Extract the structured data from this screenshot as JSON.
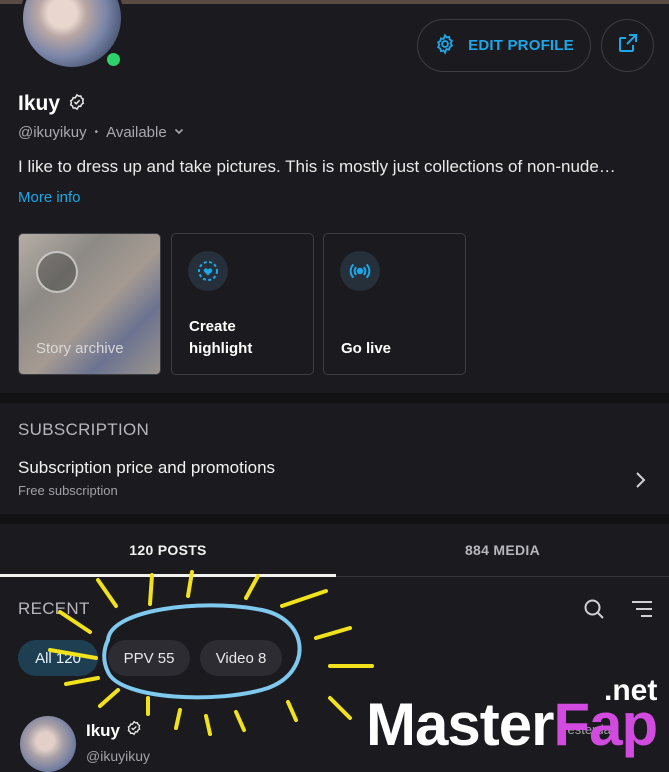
{
  "profile": {
    "name": "Ikuy",
    "handle": "@ikuyikuy",
    "status": "Available",
    "bio": "I like to dress up and take pictures. This is mostly just collections of non-nude…",
    "more_info": "More info",
    "edit_label": "EDIT PROFILE"
  },
  "cards": {
    "story_archive": "Story archive",
    "create_highlight_line1": "Create",
    "create_highlight_line2": "highlight",
    "go_live": "Go live"
  },
  "subscription": {
    "heading": "SUBSCRIPTION",
    "item_title": "Subscription price and promotions",
    "item_subtitle": "Free subscription"
  },
  "tabs": [
    {
      "label": "120 POSTS",
      "active": true
    },
    {
      "label": "884 MEDIA",
      "active": false
    }
  ],
  "feed": {
    "heading": "RECENT",
    "filters": [
      {
        "label": "All 120",
        "selected": true
      },
      {
        "label": "PPV 55",
        "selected": false
      },
      {
        "label": "Video 8",
        "selected": false
      }
    ]
  },
  "post": {
    "author": "Ikuy",
    "handle": "@ikuyikuy",
    "time": "Yesterday"
  },
  "watermark": {
    "master": "Master",
    "fap": "Fap",
    "net": ".net"
  },
  "colors": {
    "accent": "#1da7e8",
    "online": "#2fd16b",
    "annotation_yellow": "#f2e21b",
    "annotation_blue": "#7fc8ee",
    "watermark_pink": "#d24be0"
  },
  "icons": [
    "gear-icon",
    "share-icon",
    "verified-icon",
    "chevron-down-icon",
    "highlight-icon",
    "live-broadcast-icon",
    "chevron-right-icon",
    "search-icon",
    "sort-icon"
  ]
}
